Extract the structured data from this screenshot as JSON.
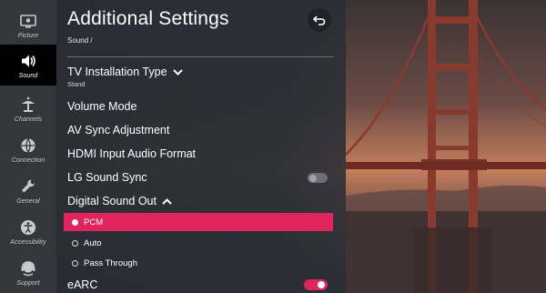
{
  "sidebar": {
    "items": [
      {
        "label": "Picture",
        "icon": "picture-icon",
        "active": false
      },
      {
        "label": "Sound",
        "icon": "speaker-icon",
        "active": true
      },
      {
        "label": "Channels",
        "icon": "antenna-icon",
        "active": false
      },
      {
        "label": "Connection",
        "icon": "globe-icon",
        "active": false
      },
      {
        "label": "General",
        "icon": "wrench-icon",
        "active": false
      },
      {
        "label": "Accessibility",
        "icon": "accessibility-icon",
        "active": false
      },
      {
        "label": "Support",
        "icon": "headset-icon",
        "active": false
      }
    ]
  },
  "header": {
    "title": "Additional Settings",
    "breadcrumb": "Sound /",
    "back_icon": "back-arrow-icon"
  },
  "menu": {
    "tv_installation": {
      "label": "TV Installation Type",
      "value": "Stand"
    },
    "volume_mode": "Volume Mode",
    "av_sync": "AV Sync Adjustment",
    "hdmi_audio": "HDMI Input Audio Format",
    "lg_sound_sync": {
      "label": "LG Sound Sync",
      "enabled": false
    },
    "digital_sound_out": {
      "label": "Digital Sound Out",
      "options": [
        "PCM",
        "Auto",
        "Pass Through"
      ],
      "selected": "PCM"
    },
    "earc": {
      "label": "eARC",
      "enabled": true
    }
  },
  "colors": {
    "accent": "#e0245e",
    "panel": "#2a2e37",
    "rail": "#33363d"
  }
}
